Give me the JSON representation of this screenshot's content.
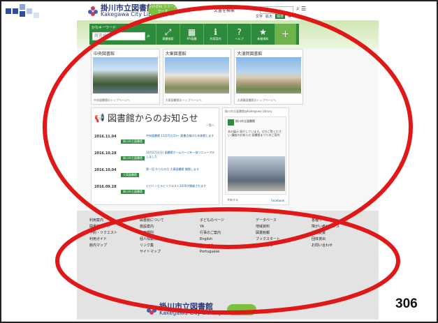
{
  "brand": {
    "name_ja": "掛川市立図書館",
    "name_en": "Kakegawa City Library",
    "badge": "かけがわ\nリリースでーす"
  },
  "topbar": {
    "search_label": "文書を検索",
    "links": [
      "文字",
      "拡大",
      "標準",
      "英"
    ],
    "highlight_link": "標準"
  },
  "navbar": {
    "search_title": "かなキーワード",
    "search_placeholder": "蔵書検索",
    "items": [
      {
        "icon": "⤢",
        "label": "蔵書検索"
      },
      {
        "icon": "▦",
        "label": "MY図書"
      },
      {
        "icon": "ℹ",
        "label": "利用案内"
      },
      {
        "icon": "?",
        "label": "ヘルプ"
      },
      {
        "icon": "★",
        "label": "新着資料"
      }
    ]
  },
  "branches": [
    {
      "title": "中央図書館",
      "link": "中央図書館のトップページへ"
    },
    {
      "title": "大東図書館",
      "link": "大東図書館のトップページへ"
    },
    {
      "title": "大須賀図書館",
      "link": "大須賀図書館のトップページへ"
    }
  ],
  "news": {
    "title": "図書館からのお知らせ",
    "more": "一覧へ",
    "items": [
      {
        "date": "2016.11.04",
        "tag": "掛川市立図書館",
        "text": "中央図書館 11月7日(月)〜 蔵書点検のため休館します"
      },
      {
        "date": "2016.10.28",
        "tag": "掛川市立図書館",
        "text": "10月27日(日) 図書館ホームページを一部リニューアルしました"
      },
      {
        "date": "2016.10.04",
        "tag": "大東図書館",
        "text": "第一回 からだの日 大東図書館 開館します"
      },
      {
        "date": "2016.09.28",
        "tag": "掛川市立図書館",
        "text": "ヒロインとルビリクエスト2016が開催されます"
      }
    ]
  },
  "sns": {
    "header": "掛川市立図書館@Kakegawa Library",
    "name": "掛川市立図書館",
    "sub": "@kakegawalibrary",
    "body": "本の展示 紹介しています。ぜひご覧ください 講座のお知らせ 図書館まつりのご案内",
    "foot_left": "共有する",
    "foot_right": "Facebook"
  },
  "footer": {
    "columns": [
      [
        "利用案内",
        "図書館カード",
        "予約・リクエスト",
        "利用ガイド",
        "館内マップ"
      ],
      [
        "図書館について",
        "施設案内",
        "利用規則",
        "個人情報保護",
        "リンク集",
        "サイトマップ"
      ],
      [
        "子どものページ",
        "YA",
        "行事のご案内",
        "English",
        "Spanish",
        "Portuguese"
      ],
      [
        "データベース",
        "地域資料",
        "図書館報",
        "ブックスタート",
        "おすすめ本"
      ],
      [
        "各種サービス",
        "障がい者サービス",
        "学校支援",
        "団体貸出",
        "お問い合わせ"
      ]
    ]
  },
  "page_number": "306"
}
